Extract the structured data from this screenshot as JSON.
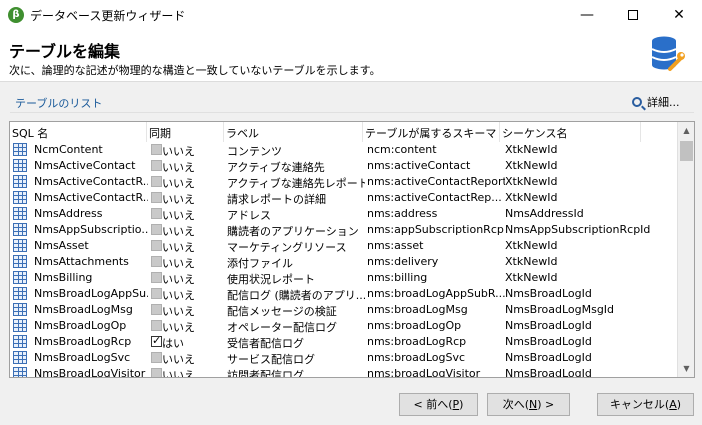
{
  "window": {
    "app_icon_glyph": "β",
    "title": "データベース更新ウィザード",
    "minimize": "—",
    "close": "✕"
  },
  "header": {
    "title": "テーブルを編集",
    "description": "次に、論理的な記述が物理的な構造と一致していないテーブルを示します。"
  },
  "section": {
    "title": "テーブルのリスト",
    "details_link": "詳細..."
  },
  "columns": {
    "name": "SQL 名",
    "sync": "同期",
    "label": "ラベル",
    "schema": "テーブルが属するスキーマ",
    "sequence": "シーケンス名"
  },
  "rows": [
    {
      "name": "NcmContent",
      "sync_checked": false,
      "sync": "いいえ",
      "label": "コンテンツ",
      "schema": "ncm:content",
      "sequence": "XtkNewId"
    },
    {
      "name": "NmsActiveContact",
      "sync_checked": false,
      "sync": "いいえ",
      "label": "アクティブな連絡先",
      "schema": "nms:activeContact",
      "sequence": "XtkNewId"
    },
    {
      "name": "NmsActiveContactR...",
      "sync_checked": false,
      "sync": "いいえ",
      "label": "アクティブな連絡先レポート",
      "schema": "nms:activeContactReport",
      "sequence": "XtkNewId"
    },
    {
      "name": "NmsActiveContactR...",
      "sync_checked": false,
      "sync": "いいえ",
      "label": "請求レポートの詳細",
      "schema": "nms:activeContactRep...",
      "sequence": "XtkNewId"
    },
    {
      "name": "NmsAddress",
      "sync_checked": false,
      "sync": "いいえ",
      "label": "アドレス",
      "schema": "nms:address",
      "sequence": "NmsAddressId"
    },
    {
      "name": "NmsAppSubscriptio...",
      "sync_checked": false,
      "sync": "いいえ",
      "label": "購読者のアプリケーション",
      "schema": "nms:appSubscriptionRcp",
      "sequence": "NmsAppSubscriptionRcpId"
    },
    {
      "name": "NmsAsset",
      "sync_checked": false,
      "sync": "いいえ",
      "label": "マーケティングリソース",
      "schema": "nms:asset",
      "sequence": "XtkNewId"
    },
    {
      "name": "NmsAttachments",
      "sync_checked": false,
      "sync": "いいえ",
      "label": "添付ファイル",
      "schema": "nms:delivery",
      "sequence": "XtkNewId"
    },
    {
      "name": "NmsBilling",
      "sync_checked": false,
      "sync": "いいえ",
      "label": "使用状況レポート",
      "schema": "nms:billing",
      "sequence": "XtkNewId"
    },
    {
      "name": "NmsBroadLogAppSu...",
      "sync_checked": false,
      "sync": "いいえ",
      "label": "配信ログ (購読者のアプリ...",
      "schema": "nms:broadLogAppSubR...",
      "sequence": "NmsBroadLogId"
    },
    {
      "name": "NmsBroadLogMsg",
      "sync_checked": false,
      "sync": "いいえ",
      "label": "配信メッセージの検証",
      "schema": "nms:broadLogMsg",
      "sequence": "NmsBroadLogMsgId"
    },
    {
      "name": "NmsBroadLogOp",
      "sync_checked": false,
      "sync": "いいえ",
      "label": "オペレーター配信ログ",
      "schema": "nms:broadLogOp",
      "sequence": "NmsBroadLogId"
    },
    {
      "name": "NmsBroadLogRcp",
      "sync_checked": true,
      "sync": "はい",
      "label": "受信者配信ログ",
      "schema": "nms:broadLogRcp",
      "sequence": "NmsBroadLogId"
    },
    {
      "name": "NmsBroadLogSvc",
      "sync_checked": false,
      "sync": "いいえ",
      "label": "サービス配信ログ",
      "schema": "nms:broadLogSvc",
      "sequence": "NmsBroadLogId"
    },
    {
      "name": "NmsBroadLogVisitor",
      "sync_checked": false,
      "sync": "いいえ",
      "label": "訪問者配信ログ",
      "schema": "nms:broadLogVisitor",
      "sequence": "NmsBroadLogId"
    }
  ],
  "buttons": {
    "back": {
      "text": "< 前へ(",
      "key": "P",
      "end": ")"
    },
    "next": {
      "text": "次へ(",
      "key": "N",
      "end": ") >"
    },
    "cancel": {
      "text": "キャンセル(",
      "key": "A",
      "end": ")"
    }
  },
  "icons": [
    "app-logo-icon",
    "window-minimize-icon",
    "window-maximize-icon",
    "window-close-icon",
    "database-wrench-icon",
    "magnifier-icon",
    "table-icon",
    "checkbox-icon",
    "scroll-up-arrow-icon",
    "scroll-down-arrow-icon"
  ],
  "colors": {
    "section_title": "#1a5a9a",
    "table_icon": "#3b6fb6",
    "db_icon": "#2a6fc9",
    "wrench": "#f2a020"
  }
}
